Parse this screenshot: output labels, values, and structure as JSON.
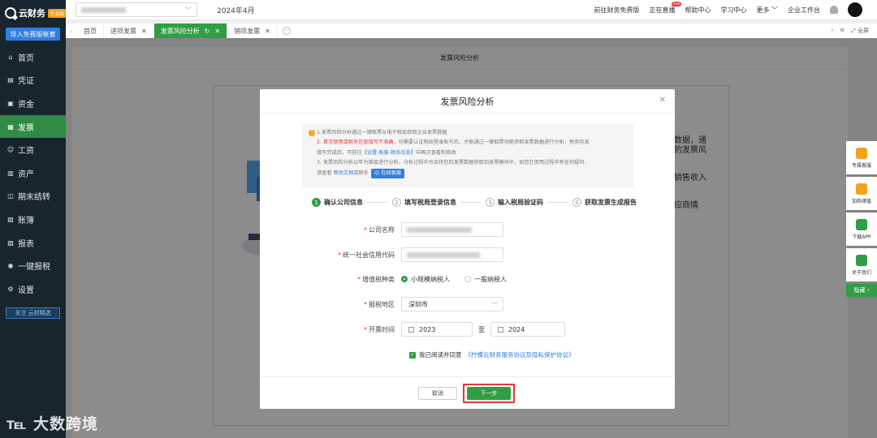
{
  "sidebar": {
    "logo": "云财务",
    "logo_badge": "专业版",
    "import_button": "导入免费版帐套",
    "items": [
      {
        "label": "首页",
        "icon": "home-icon"
      },
      {
        "label": "凭证",
        "icon": "voucher-icon"
      },
      {
        "label": "资金",
        "icon": "fund-icon"
      },
      {
        "label": "发票",
        "icon": "invoice-icon"
      },
      {
        "label": "工资",
        "icon": "salary-icon"
      },
      {
        "label": "资产",
        "icon": "asset-icon"
      },
      {
        "label": "期末结转",
        "icon": "period-close-icon"
      },
      {
        "label": "账簿",
        "icon": "ledger-icon"
      },
      {
        "label": "报表",
        "icon": "report-icon"
      },
      {
        "label": "一键报税",
        "icon": "tax-icon"
      },
      {
        "label": "设置",
        "icon": "settings-icon"
      }
    ],
    "active_index": 3,
    "follow_label": "关注 云财精选"
  },
  "topbar": {
    "period": "2024年4月",
    "links": [
      "前往财务免费版",
      "正在直播",
      "帮助中心",
      "学习中心",
      "更多",
      "企业工作台"
    ],
    "live_badge": "live"
  },
  "tabs": [
    {
      "label": "首页",
      "closable": false
    },
    {
      "label": "进项发票",
      "closable": true
    },
    {
      "label": "发票风险分析",
      "closable": true,
      "active": true
    },
    {
      "label": "销项发票",
      "closable": true
    }
  ],
  "tab_right": {
    "fullscreen": "全屏"
  },
  "page": {
    "title": "发票风险分析",
    "bg_fragments": [
      "数据，通",
      "的发票风",
      "销售收入",
      "应商情"
    ]
  },
  "modal": {
    "title": "发票风险分析",
    "notice": {
      "line1": "1.发票风险分析通过一键取票从电子税局获取企业发票数据",
      "line2_red": "2. 首次使用或税务信息填写不准确，",
      "line2_rest": "均需要认证税局登录账号后，才能通过一键取票功能获取发票数据进行分析；税务信息",
      "line3a": "填写完成后，可前往",
      "line3_link": "【设置-账套-税务信息】",
      "line3b": "中再次查看和修改",
      "line4": "3. 发票风险分析以年为维度进行分析，分析过程中也会将您的发票数据获取到发票模块中，如您在使用过程中有任何疑问，",
      "line5a": "请查看",
      "line5_link": "帮助文档",
      "line5b": "或联系",
      "service_button": "在线客服"
    },
    "steps": [
      {
        "num": "1",
        "label": "确认公司信息"
      },
      {
        "num": "2",
        "label": "填写税局登录信息"
      },
      {
        "num": "3",
        "label": "输入税局验证码"
      },
      {
        "num": "4",
        "label": "获取发票生成报告"
      }
    ],
    "form": {
      "company_label": "公司名称",
      "credit_label": "统一社会信用代码",
      "tax_type_label": "增值税种类",
      "tax_options": [
        "小规模纳税人",
        "一般纳税人"
      ],
      "selected_tax_option": "小规模纳税人",
      "region_label": "报税地区",
      "region_value": "深圳市",
      "time_label": "开票时间",
      "time_from": "2023",
      "time_to": "2024",
      "range_sep": "至"
    },
    "agreement_prefix": "我已阅读并同意",
    "agreement_link": "《柠檬云财务服务协议及隐私保护协议》",
    "cancel": "取消",
    "next": "下一步"
  },
  "right_rail": [
    {
      "label": "专属客服",
      "color": "#f4a11c"
    },
    {
      "label": "加购储值",
      "color": "#f4a11c"
    },
    {
      "label": "下载APP",
      "color": "#2f9e44"
    },
    {
      "label": "关于我们",
      "color": "#2f9e44"
    }
  ],
  "right_rail_hide": "隐藏 ›",
  "watermark": "大数跨境"
}
